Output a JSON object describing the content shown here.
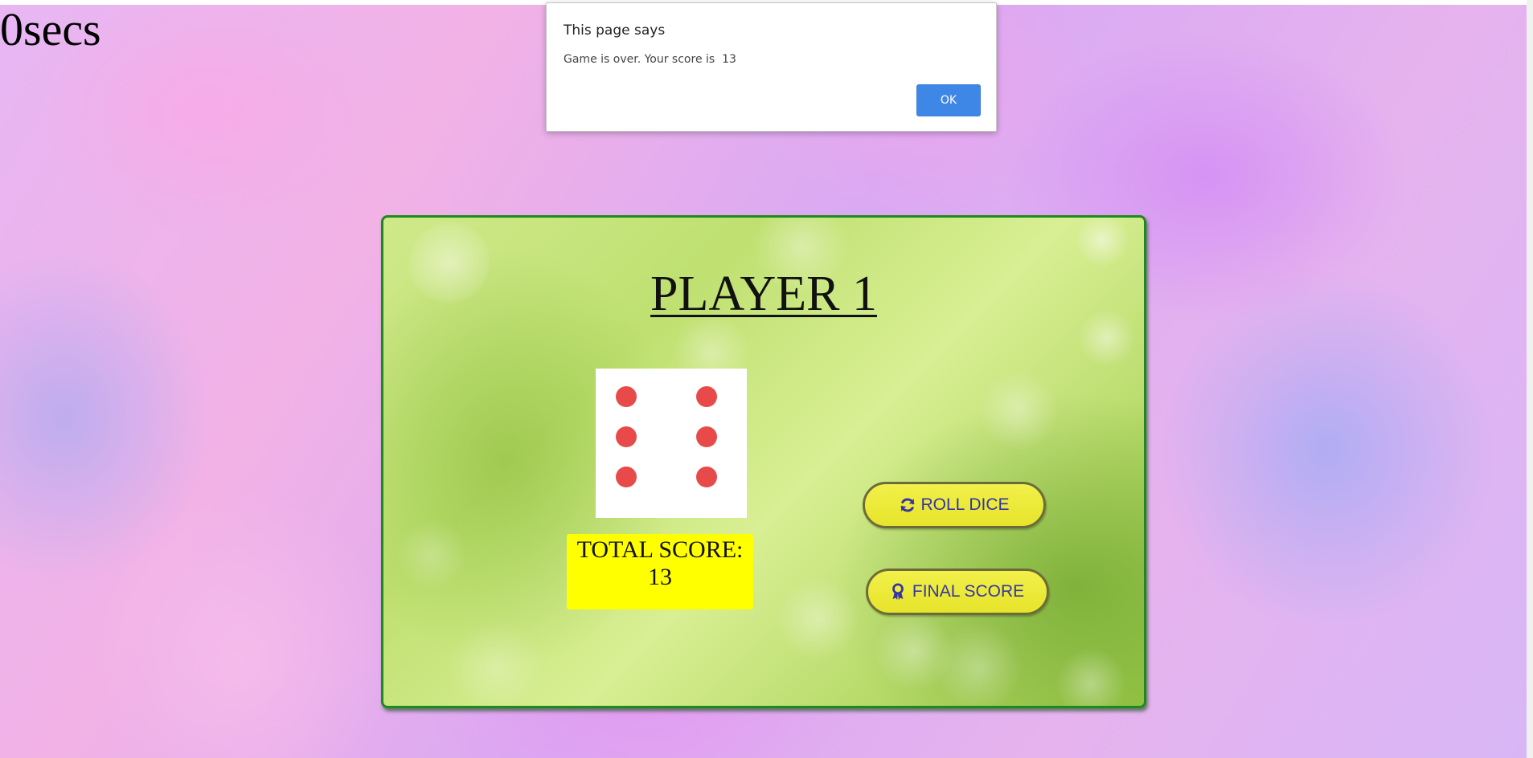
{
  "timer": {
    "text": "0secs"
  },
  "game": {
    "player_title": "PLAYER 1",
    "die": {
      "face_value": 6,
      "pip_color": "#e84a4a"
    },
    "score": {
      "label": "TOTAL SCORE:",
      "value": "13"
    },
    "buttons": {
      "roll": {
        "label": "ROLL DICE",
        "icon": "refresh-icon"
      },
      "final": {
        "label": "FINAL SCORE",
        "icon": "award-icon"
      }
    }
  },
  "dialog": {
    "title": "This page says",
    "message": "Game is over. Your score is  13",
    "ok_label": "OK"
  },
  "colors": {
    "card_border": "#1d8a1d",
    "score_box": "#ffff00",
    "button_fill": "#eceb3a",
    "button_text": "#3535a5",
    "ok_button": "#3f87e6"
  }
}
